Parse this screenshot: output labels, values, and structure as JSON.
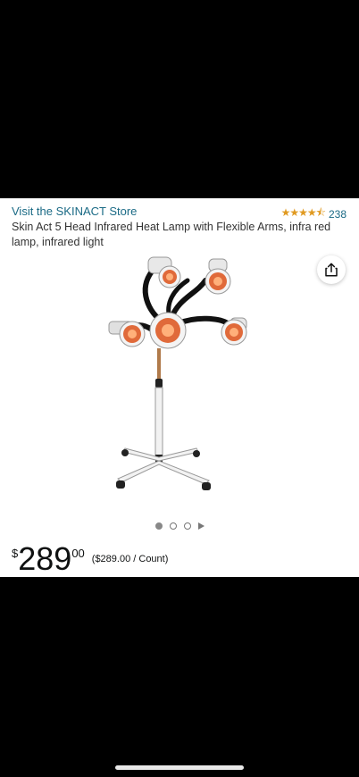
{
  "store": {
    "link_text": "Visit the SKINACT Store"
  },
  "rating": {
    "stars": "★★★★⯪",
    "count": "238",
    "star_color": "#e09a21"
  },
  "product": {
    "title": "Skin Act 5 Head Infrared Heat Lamp with Flexible Arms, infra red lamp, infrared light",
    "share_icon": "share-icon"
  },
  "carousel": {
    "dots": 3,
    "active_index": 0,
    "has_video": true
  },
  "price": {
    "symbol": "$",
    "whole": "289",
    "fraction": "00",
    "unit_price": "($289.00 / Count)"
  }
}
